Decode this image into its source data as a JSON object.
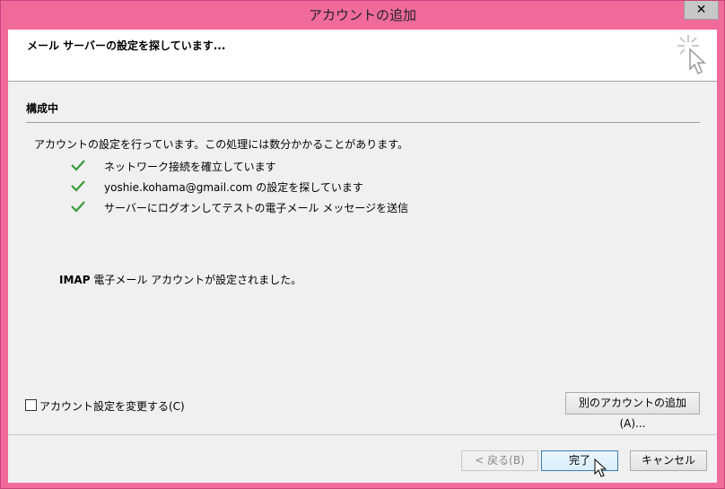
{
  "window": {
    "title": "アカウントの追加",
    "close_label": "✕"
  },
  "header": {
    "text": "メール サーバーの設定を探しています..."
  },
  "section": {
    "title": "構成中",
    "intro": "アカウントの設定を行っています。この処理には数分かかることがあります。"
  },
  "steps": [
    {
      "label": "ネットワーク接続を確立しています",
      "status": "done"
    },
    {
      "label": "yoshie.kohama@gmail.com の設定を探しています",
      "status": "done"
    },
    {
      "label": "サーバーにログオンしてテストの電子メール メッセージを送信",
      "status": "done"
    }
  ],
  "result": {
    "protocol": "IMAP",
    "message": " 電子メール アカウントが設定されました。"
  },
  "options": {
    "change_settings_label": "アカウント設定を変更する(C)",
    "change_settings_checked": false,
    "add_another_label": "別のアカウントの追加(A)..."
  },
  "footer": {
    "back_label": "< 戻る(B)",
    "finish_label": "完了",
    "cancel_label": "キャンセル"
  },
  "colors": {
    "titlebar": "#f06b9a",
    "check": "#3a9a3a"
  }
}
